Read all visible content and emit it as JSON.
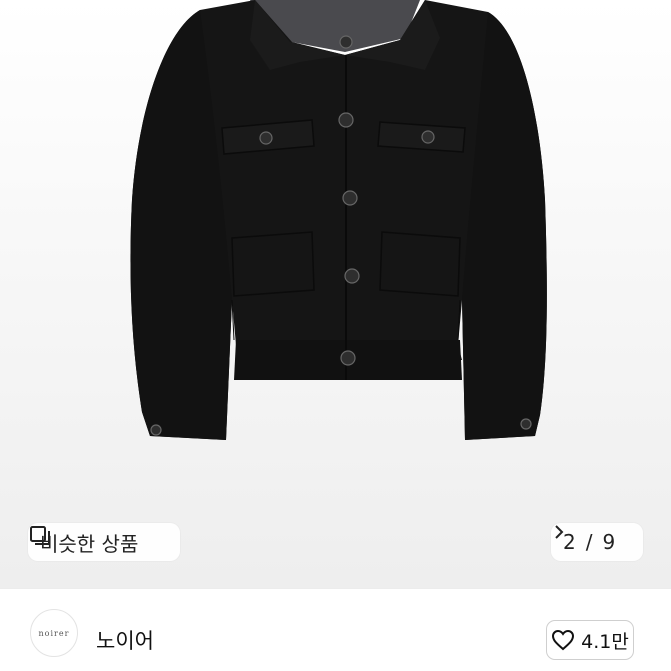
{
  "product": {
    "image_alt": "black jacket"
  },
  "similar": {
    "label": "비슷한 상품",
    "icon": "similar-items-icon"
  },
  "gallery": {
    "current": "2",
    "separator": "/",
    "total": "9",
    "next_icon": "chevron-right-icon"
  },
  "seller": {
    "avatar_text": "noirer",
    "name": "노이어"
  },
  "like": {
    "icon": "heart-outline-icon",
    "count": "4.1만"
  }
}
